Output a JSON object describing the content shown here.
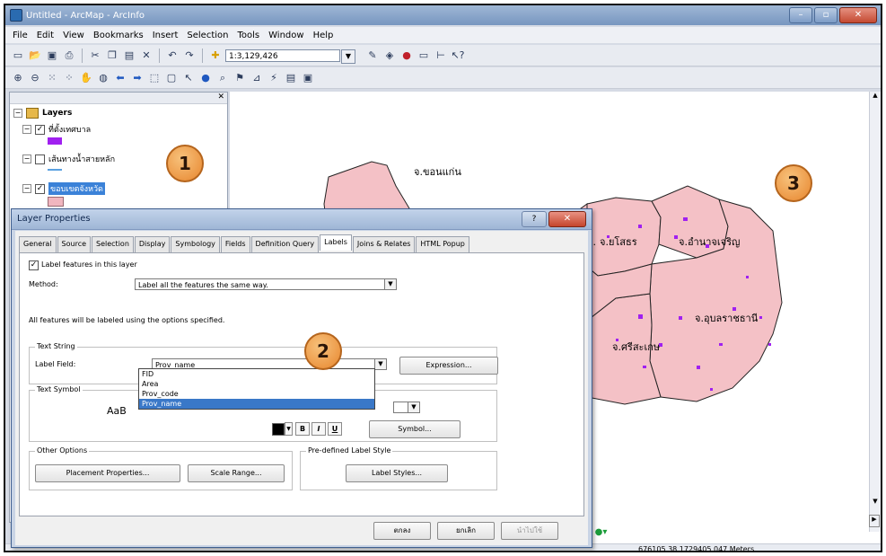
{
  "window": {
    "title": "Untitled - ArcMap - ArcInfo"
  },
  "menu": [
    "File",
    "Edit",
    "View",
    "Bookmarks",
    "Insert",
    "Selection",
    "Tools",
    "Window",
    "Help"
  ],
  "toolbar": {
    "scale": "1:3,129,426"
  },
  "toc": {
    "root": "Layers",
    "layers": [
      {
        "name": "ที่ตั้งเทศบาล",
        "checked": true,
        "swatch": "#a020f0"
      },
      {
        "name": "เส้นทางน้ำสายหลัก",
        "checked": false,
        "swatch": "#5aa0e0"
      },
      {
        "name": "ขอบเขตจังหวัด",
        "checked": true,
        "swatch": "#f0b6bf",
        "selected": true
      }
    ]
  },
  "callouts": [
    "1",
    "2",
    "3"
  ],
  "map": {
    "fill": "#f4c1c6",
    "labels": [
      "จ.ขอนแก่น",
      "จ.ยโสธร",
      "จ.อำนาจเจริญ",
      "จ.อุบลราชธานี",
      "จ.ศรีสะเกษ",
      "จ."
    ]
  },
  "dialog": {
    "title": "Layer Properties",
    "tabs": [
      "General",
      "Source",
      "Selection",
      "Display",
      "Symbology",
      "Fields",
      "Definition Query",
      "Labels",
      "Joins & Relates",
      "HTML Popup"
    ],
    "active_tab": "Labels",
    "label_features_text": "Label features in this layer",
    "label_features_checked": true,
    "method_label": "Method:",
    "method_value": "Label all the features the same way.",
    "info_text": "All features will be labeled using the options specified.",
    "text_string_group": "Text String",
    "label_field_label": "Label Field:",
    "label_field_value": "Prov_name",
    "expression_button": "Expression...",
    "field_options": [
      "FID",
      "Area",
      "Prov_code",
      "Prov_name"
    ],
    "text_symbol_group": "Text Symbol",
    "sample_text": "AaB",
    "bold": "B",
    "italic": "I",
    "underline": "U",
    "symbol_button": "Symbol...",
    "other_options_group": "Other Options",
    "placement_button": "Placement Properties...",
    "scale_range_button": "Scale Range...",
    "predefined_group": "Pre-defined Label Style",
    "label_styles_button": "Label Styles...",
    "ok_button": "ตกลง",
    "cancel_button": "ยกเลิก",
    "apply_button": "นำไปใช้"
  },
  "status": {
    "coords": "676105.38 1729405.047 Meters"
  }
}
